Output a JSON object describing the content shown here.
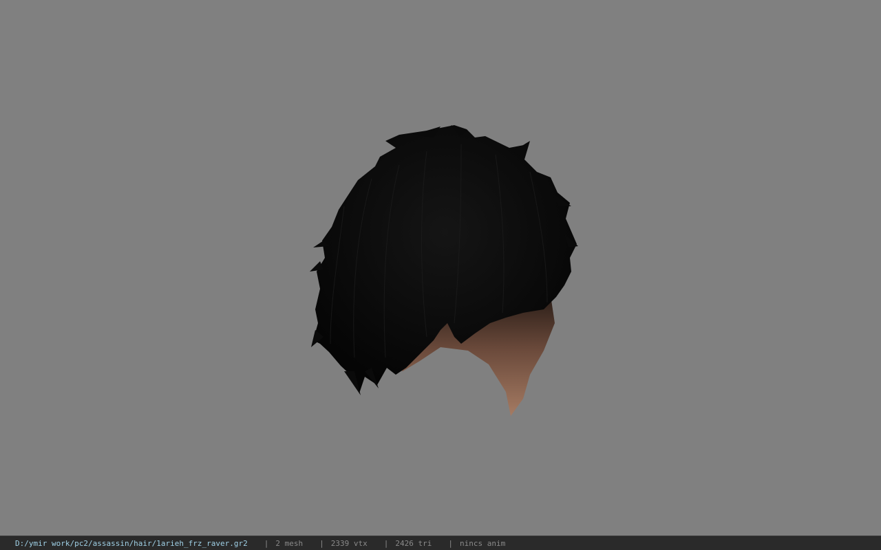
{
  "viewport": {
    "background_color": "#808080",
    "model": "hair-mesh"
  },
  "status_bar": {
    "file_path": "D:/ymir work/pc2/assassin/hair/1arieh_frz_raver.gr2",
    "separator": "|",
    "mesh_count": "2 mesh",
    "vertex_count": "2339 vtx",
    "triangle_count": "2426 tri",
    "anim_status": "nincs anim",
    "path_color": "#9fd0e6",
    "text_color": "#8a8a8a"
  }
}
